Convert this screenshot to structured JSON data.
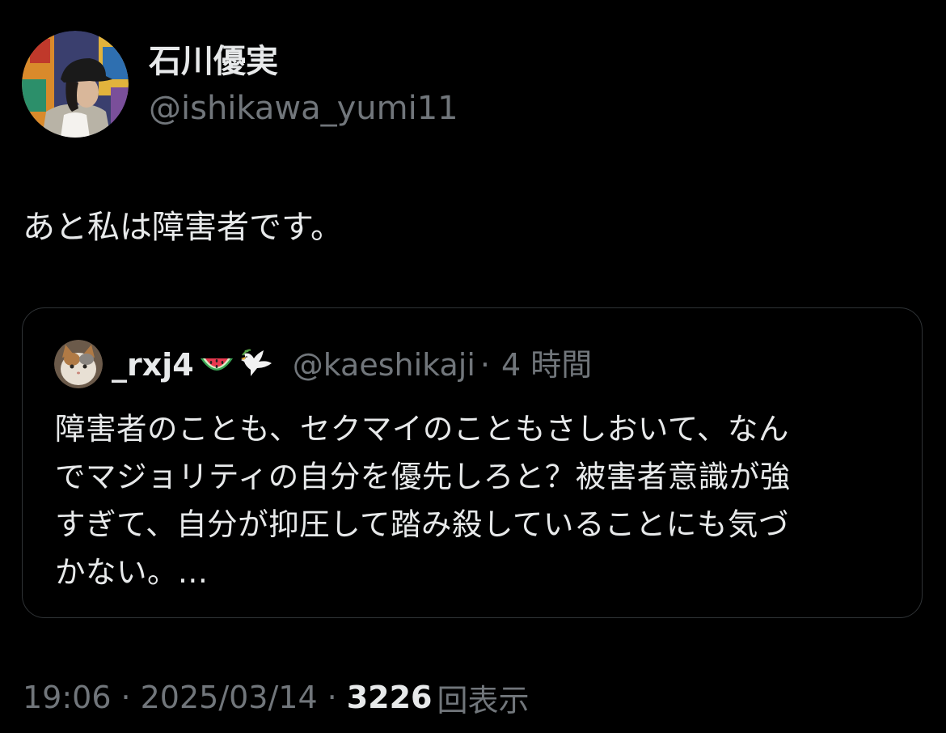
{
  "author": {
    "display_name": "石川優実",
    "handle": "@ishikawa_yumi11",
    "avatar_icon": "avatar-photo"
  },
  "tweet": {
    "text": "あと私は障害者です。"
  },
  "quote": {
    "display_name": "_rxj4",
    "name_emojis": [
      "watermelon-icon",
      "dove-icon"
    ],
    "handle": "@kaeshikaji",
    "separator": "·",
    "time": "4 時間",
    "avatar_icon": "cat-avatar",
    "body": "障害者のことも、セクマイのこともさしおいて、なん\nでマジョリティの自分を優先しろと？被害者意識が強\nすぎて、自分が抑圧して踏み殺していることにも気づ\nかない。..."
  },
  "meta": {
    "time": "19:06",
    "separator": "·",
    "date": "2025/03/14",
    "views_count": "3226",
    "views_label": "回表示"
  },
  "colors": {
    "background": "#000000",
    "primary_text": "#e7e9ea",
    "secondary_text": "#71767b",
    "border": "#2f3336"
  }
}
